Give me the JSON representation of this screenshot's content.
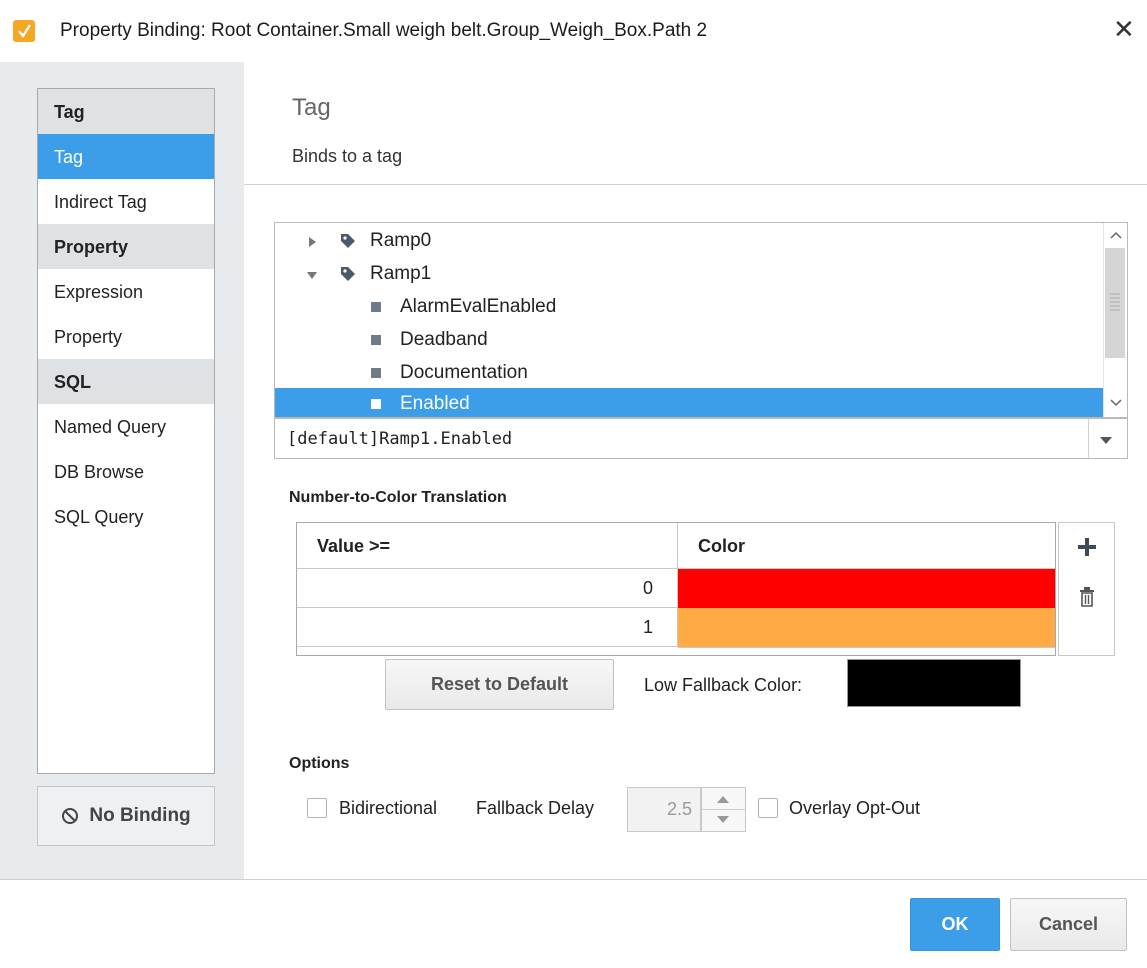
{
  "window": {
    "title": "Property Binding: Root Container.Small weigh belt.Group_Weigh_Box.Path 2",
    "close_glyph": "✕",
    "icon": "ignition-binding-icon"
  },
  "sidebar": {
    "groups": [
      {
        "header": "Tag",
        "items": [
          "Tag",
          "Indirect Tag"
        ]
      },
      {
        "header": "Property",
        "items": [
          "Expression",
          "Property"
        ]
      },
      {
        "header": "SQL",
        "items": [
          "Named Query",
          "DB Browse",
          "SQL Query"
        ]
      }
    ],
    "selected": "Tag",
    "no_binding_label": "No Binding"
  },
  "header": {
    "title": "Tag",
    "subtitle": "Binds to a tag"
  },
  "tag_tree": {
    "rows": [
      {
        "label": "Ramp0",
        "kind": "folder",
        "expanded": false,
        "selected": false
      },
      {
        "label": "Ramp1",
        "kind": "folder",
        "expanded": true,
        "selected": false
      },
      {
        "label": "AlarmEvalEnabled",
        "kind": "property",
        "selected": false
      },
      {
        "label": "Deadband",
        "kind": "property",
        "selected": false
      },
      {
        "label": "Documentation",
        "kind": "property",
        "selected": false
      },
      {
        "label": "Enabled",
        "kind": "property",
        "selected": true
      }
    ],
    "path_value": "[default]Ramp1.Enabled"
  },
  "color_translation": {
    "section_label": "Number-to-Color Translation",
    "col_value": "Value >=",
    "col_color": "Color",
    "rows": [
      {
        "value": "0",
        "color": "#ff0000"
      },
      {
        "value": "1",
        "color": "#ffaa44"
      }
    ],
    "reset_label": "Reset to Default",
    "low_fallback_label": "Low Fallback Color:",
    "low_fallback_color": "#000000"
  },
  "options": {
    "section_label": "Options",
    "bidirectional_label": "Bidirectional",
    "fallback_delay_label": "Fallback Delay",
    "fallback_delay_value": "2.5",
    "overlay_label": "Overlay Opt-Out",
    "bidirectional_checked": false,
    "overlay_checked": false
  },
  "footer": {
    "ok_label": "OK",
    "cancel_label": "Cancel"
  },
  "colors": {
    "accent": "#3c9ee8",
    "selection": "#3c9ee8"
  }
}
